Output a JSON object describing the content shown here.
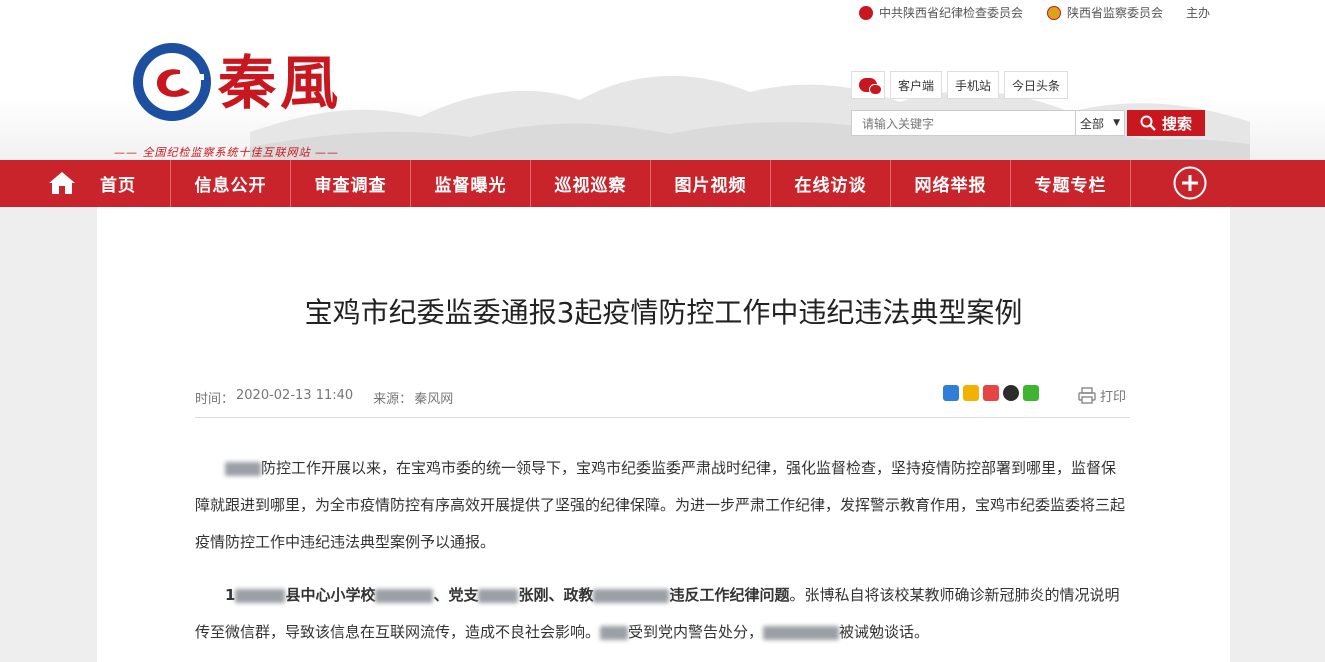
{
  "topbar": {
    "links": [
      "中共陕西省纪律检查委员会",
      "陕西省监察委员会",
      "主办"
    ]
  },
  "brand": {
    "name": "秦風",
    "tagline": "—— 全国纪检监察系统十佳互联网站 ——",
    "accent": "#c8171e"
  },
  "quicklinks": [
    "客户端",
    "手机站",
    "今日头条"
  ],
  "search": {
    "placeholder": "请输入关键字",
    "scope": "全部",
    "button": "搜索"
  },
  "nav": {
    "items": [
      "首页",
      "信息公开",
      "审查调查",
      "监督曝光",
      "巡视巡察",
      "图片视频",
      "在线访谈",
      "网络举报",
      "专题专栏"
    ],
    "color": "#c9242b"
  },
  "article": {
    "title": "宝鸡市纪委监委通报3起疫情防控工作中违纪违法典型案例",
    "time_label": "时间：",
    "time": "2020-02-13 11:40",
    "source_label": "来源：",
    "source": "秦风网",
    "print": "打印",
    "p1": "防控工作开展以来，在宝鸡市委的统一领导下，宝鸡市纪委监委严肃战时纪律，强化监督检查，坚持疫情防控部署到哪里，监督保障就跟进到哪里，为全市疫情防控有序高效开展提供了坚强的纪律保障。为进一步严肃工作纪律，发挥警示教育作用，宝鸡市纪委监委将三起疫情防控工作中违纪违法典型案例予以通报。",
    "p2_a": "1",
    "p2_b": "县中心小学校",
    "p2_c": "、党支",
    "p2_d": "张刚、政教",
    "p2_e": "违反工作纪律问题",
    "p2_f": "。张博私自将该校某教师确诊新冠肺炎的情况说明传至微信群，导致该信息在互联网流传，造成不良社会影响。",
    "p2_g": "受到党内警告处分，",
    "p2_h": "被诫勉谈话。"
  }
}
